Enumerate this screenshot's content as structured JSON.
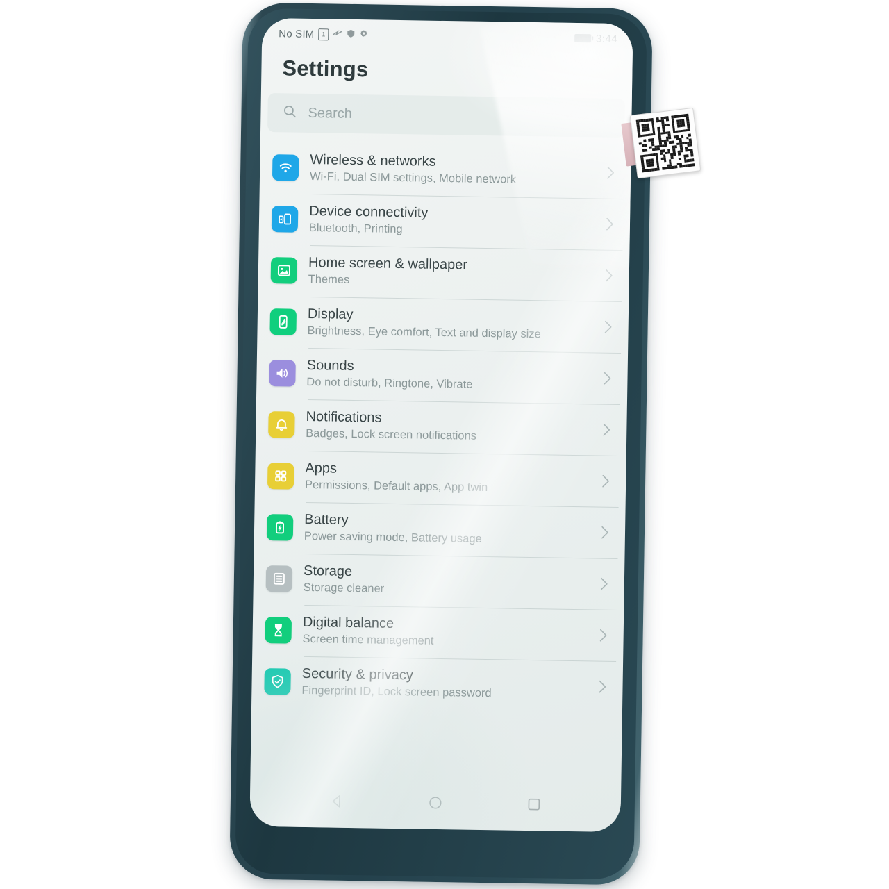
{
  "device": {
    "bezel_color": "#24414c",
    "screen_bg": "#eef2f1"
  },
  "status_bar": {
    "carrier": "No SIM",
    "sim_slot": "1",
    "icons": [
      "signal-icon",
      "shield-icon",
      "gear-icon"
    ],
    "battery_icon": "battery-icon",
    "time": "3:44"
  },
  "header": {
    "title": "Settings"
  },
  "search": {
    "icon": "search-icon",
    "placeholder": "Search",
    "value": ""
  },
  "settings_list": [
    {
      "icon": "wifi-icon",
      "color": "#1fa7e8",
      "title": "Wireless & networks",
      "subtitle": "Wi-Fi, Dual SIM settings, Mobile network"
    },
    {
      "icon": "device-connectivity-icon",
      "color": "#1fa7e8",
      "title": "Device connectivity",
      "subtitle": "Bluetooth, Printing"
    },
    {
      "icon": "wallpaper-icon",
      "color": "#12ce7d",
      "title": "Home screen & wallpaper",
      "subtitle": "Themes"
    },
    {
      "icon": "display-icon",
      "color": "#10cf7e",
      "title": "Display",
      "subtitle": "Brightness, Eye comfort, Text and display size"
    },
    {
      "icon": "sound-icon",
      "color": "#9b8ede",
      "title": "Sounds",
      "subtitle": "Do not disturb, Ringtone, Vibrate"
    },
    {
      "icon": "bell-icon",
      "color": "#e8cf36",
      "title": "Notifications",
      "subtitle": "Badges, Lock screen notifications"
    },
    {
      "icon": "apps-grid-icon",
      "color": "#e8cf36",
      "title": "Apps",
      "subtitle": "Permissions, Default apps, App twin"
    },
    {
      "icon": "battery-bolt-icon",
      "color": "#12ce7d",
      "title": "Battery",
      "subtitle": "Power saving mode, Battery usage"
    },
    {
      "icon": "storage-icon",
      "color": "#b6bfc1",
      "title": "Storage",
      "subtitle": "Storage cleaner"
    },
    {
      "icon": "hourglass-icon",
      "color": "#12ce7d",
      "title": "Digital balance",
      "subtitle": "Screen time management"
    },
    {
      "icon": "shield-check-icon",
      "color": "#17c9b0",
      "title": "Security & privacy",
      "subtitle": "Fingerprint ID, Lock screen password"
    }
  ],
  "nav_bar": {
    "back": "back-triangle-icon",
    "home": "home-circle-icon",
    "recents": "recents-square-icon"
  },
  "sticker": {
    "type": "qr-code-label"
  }
}
